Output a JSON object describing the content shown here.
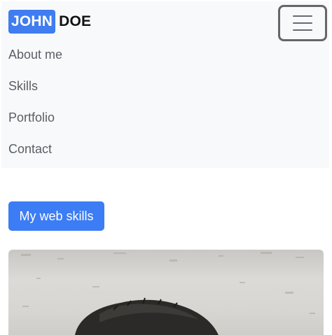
{
  "brand": {
    "first": "JOHN",
    "last": "DOE"
  },
  "toggler": {
    "icon": "hamburger-menu-icon"
  },
  "nav": {
    "items": [
      {
        "label": "About me"
      },
      {
        "label": "Skills"
      },
      {
        "label": "Portfolio"
      },
      {
        "label": "Contact"
      }
    ]
  },
  "main": {
    "skills_button_label": "My web skills",
    "photo": {
      "description": "portrait-photo"
    }
  },
  "colors": {
    "brand_bg": "#3f7df0",
    "navbar_bg": "#f8f9fa",
    "button_bg": "#3c7cf5",
    "nav_text": "#5a5f66"
  }
}
